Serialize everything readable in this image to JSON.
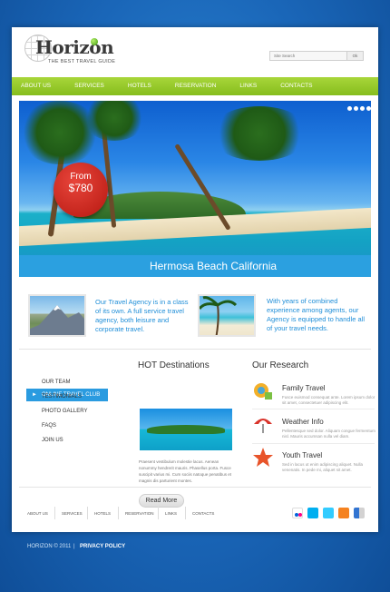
{
  "header": {
    "logo_text": "Horizon",
    "logo_tagline": "THE BEST TRAVEL GUIDE",
    "search_placeholder": "Site Search",
    "search_button": "Ok"
  },
  "nav": {
    "items": [
      "ABOUT US",
      "SERVICES",
      "HOTELS",
      "RESERVATION",
      "LINKS",
      "CONTACTS"
    ]
  },
  "banner": {
    "caption": "Hermosa Beach California",
    "price_from": "From",
    "price_value": "$780"
  },
  "features": {
    "item1": "Our Travel Agency is in a class of its own. A full service travel agency, both leisure and corporate travel.",
    "item2": "With years of combined experience among agents, our Agency is equipped to handle all of your travel needs."
  },
  "sidebar": {
    "active": "ONLINE TRAVEL CLUB",
    "items": [
      "OUR TEAM",
      "TESTIMONIALS",
      "PHOTO GALLERY",
      "FAQS",
      "JOIN US"
    ]
  },
  "hot": {
    "title": "HOT Destinations",
    "text": "Praesent vestibulum molestie lacus. Aenean nonummy hendrerit mauris. Phasellus porta. Fusce suscipit varius mi. Cum sociis natoque penatibus et magnis dis parturient montes.",
    "button": "Read More"
  },
  "research": {
    "title": "Our Research",
    "items": [
      {
        "title": "Family Travel",
        "text": "Fusce euismod consequat ante. Lorem ipsum dolor sit amet, consectetuer adipiscing elit."
      },
      {
        "title": "Weather Info",
        "text": "Pellentesque sed dolor. Aliquam congue fermentum nisl. Mauris accumsan nulla vel diam."
      },
      {
        "title": "Youth Travel",
        "text": "Sed in lacus ut enim adipiscing aliquet. Nulla venenatis. In pede mi, aliquet sit amet."
      }
    ]
  },
  "footer": {
    "links": [
      "ABOUT US",
      "SERVICES",
      "HOTELS",
      "RESERVATION",
      "LINKS",
      "CONTACTS"
    ],
    "social": [
      "flickr-icon",
      "skype-icon",
      "twitter-icon",
      "rss-icon",
      "delicious-icon"
    ],
    "copyright": "HORIZON © 2011",
    "separator": "|",
    "privacy": "PRIVACY POLICY"
  },
  "colors": {
    "nav_green": "#8fc42a",
    "accent_blue": "#2a9be0",
    "badge_red": "#d1261c"
  }
}
